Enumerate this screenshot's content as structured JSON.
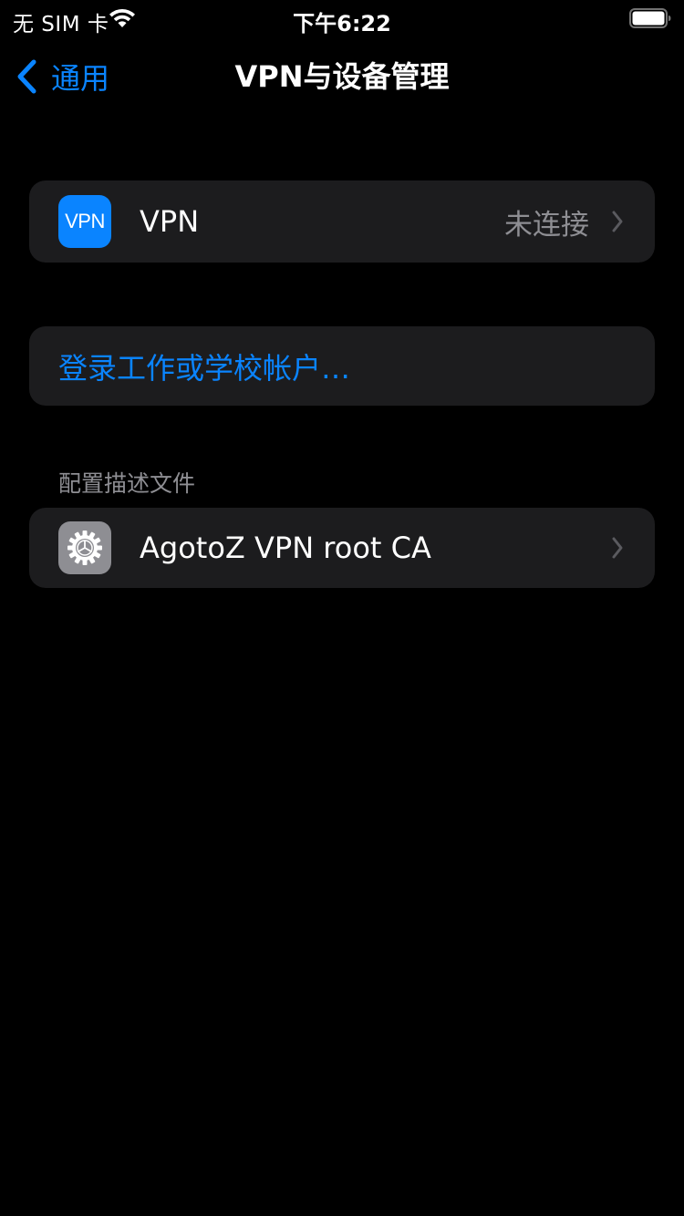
{
  "status_bar": {
    "carrier": "无 SIM 卡",
    "time": "下午6:22",
    "wifi_icon": "wifi-icon",
    "battery_icon": "battery-icon"
  },
  "nav": {
    "back_label": "通用",
    "title": "VPN与设备管理"
  },
  "vpn_row": {
    "icon_text": "VPN",
    "label": "VPN",
    "status": "未连接"
  },
  "sign_in": {
    "label": "登录工作或学校帐户…"
  },
  "profiles": {
    "header": "配置描述文件",
    "items": [
      {
        "label": "AgotoZ VPN root CA",
        "icon": "settings-gear-icon"
      }
    ]
  },
  "colors": {
    "background": "#000000",
    "cell": "#1c1c1e",
    "accent": "#0a84ff",
    "secondary_text": "#8e8e93"
  }
}
